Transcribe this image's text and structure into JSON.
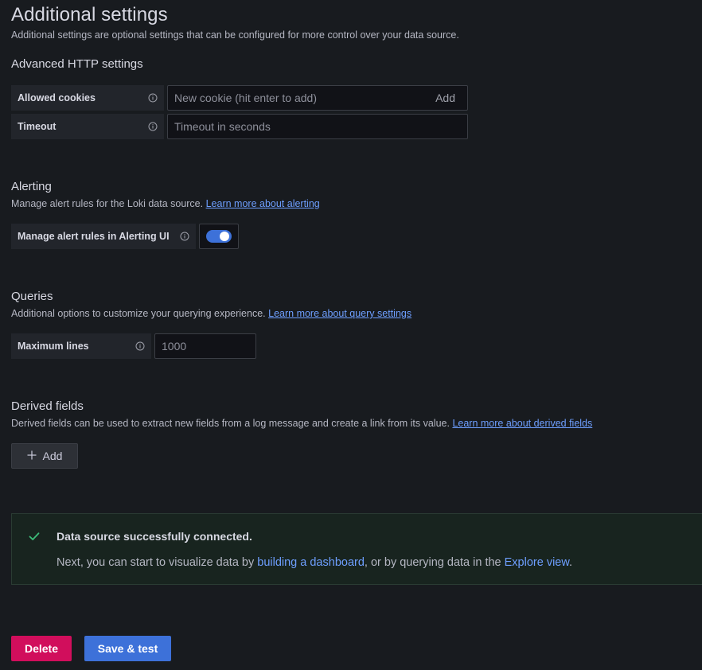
{
  "header": {
    "title": "Additional settings",
    "description": "Additional settings are optional settings that can be configured for more control over your data source."
  },
  "http": {
    "title": "Advanced HTTP settings",
    "cookies_label": "Allowed cookies",
    "cookies_placeholder": "New cookie (hit enter to add)",
    "cookies_add": "Add",
    "timeout_label": "Timeout",
    "timeout_placeholder": "Timeout in seconds"
  },
  "alerting": {
    "title": "Alerting",
    "description": "Manage alert rules for the Loki data source.",
    "link": "Learn more about alerting",
    "toggle_label": "Manage alert rules in Alerting UI",
    "toggle_on": true
  },
  "queries": {
    "title": "Queries",
    "description": "Additional options to customize your querying experience.",
    "link": "Learn more about query settings",
    "max_lines_label": "Maximum lines",
    "max_lines_placeholder": "1000"
  },
  "derived": {
    "title": "Derived fields",
    "description": "Derived fields can be used to extract new fields from a log message and create a link from its value.",
    "link": "Learn more about derived fields",
    "add_button": "Add"
  },
  "alert": {
    "title": "Data source successfully connected.",
    "body_prefix": "Next, you can start to visualize data by ",
    "link_dashboard": "building a dashboard",
    "body_middle": ", or by querying data in the ",
    "link_explore": "Explore view",
    "body_suffix": "."
  },
  "footer": {
    "delete_label": "Delete",
    "save_label": "Save & test"
  },
  "colors": {
    "background": "#181b1f",
    "primary": "#3d71d9",
    "danger": "#d10e5c",
    "link": "#6e9fff",
    "success": "#1a7f4b"
  },
  "icons": [
    "info-icon",
    "plus-icon",
    "check-icon"
  ]
}
